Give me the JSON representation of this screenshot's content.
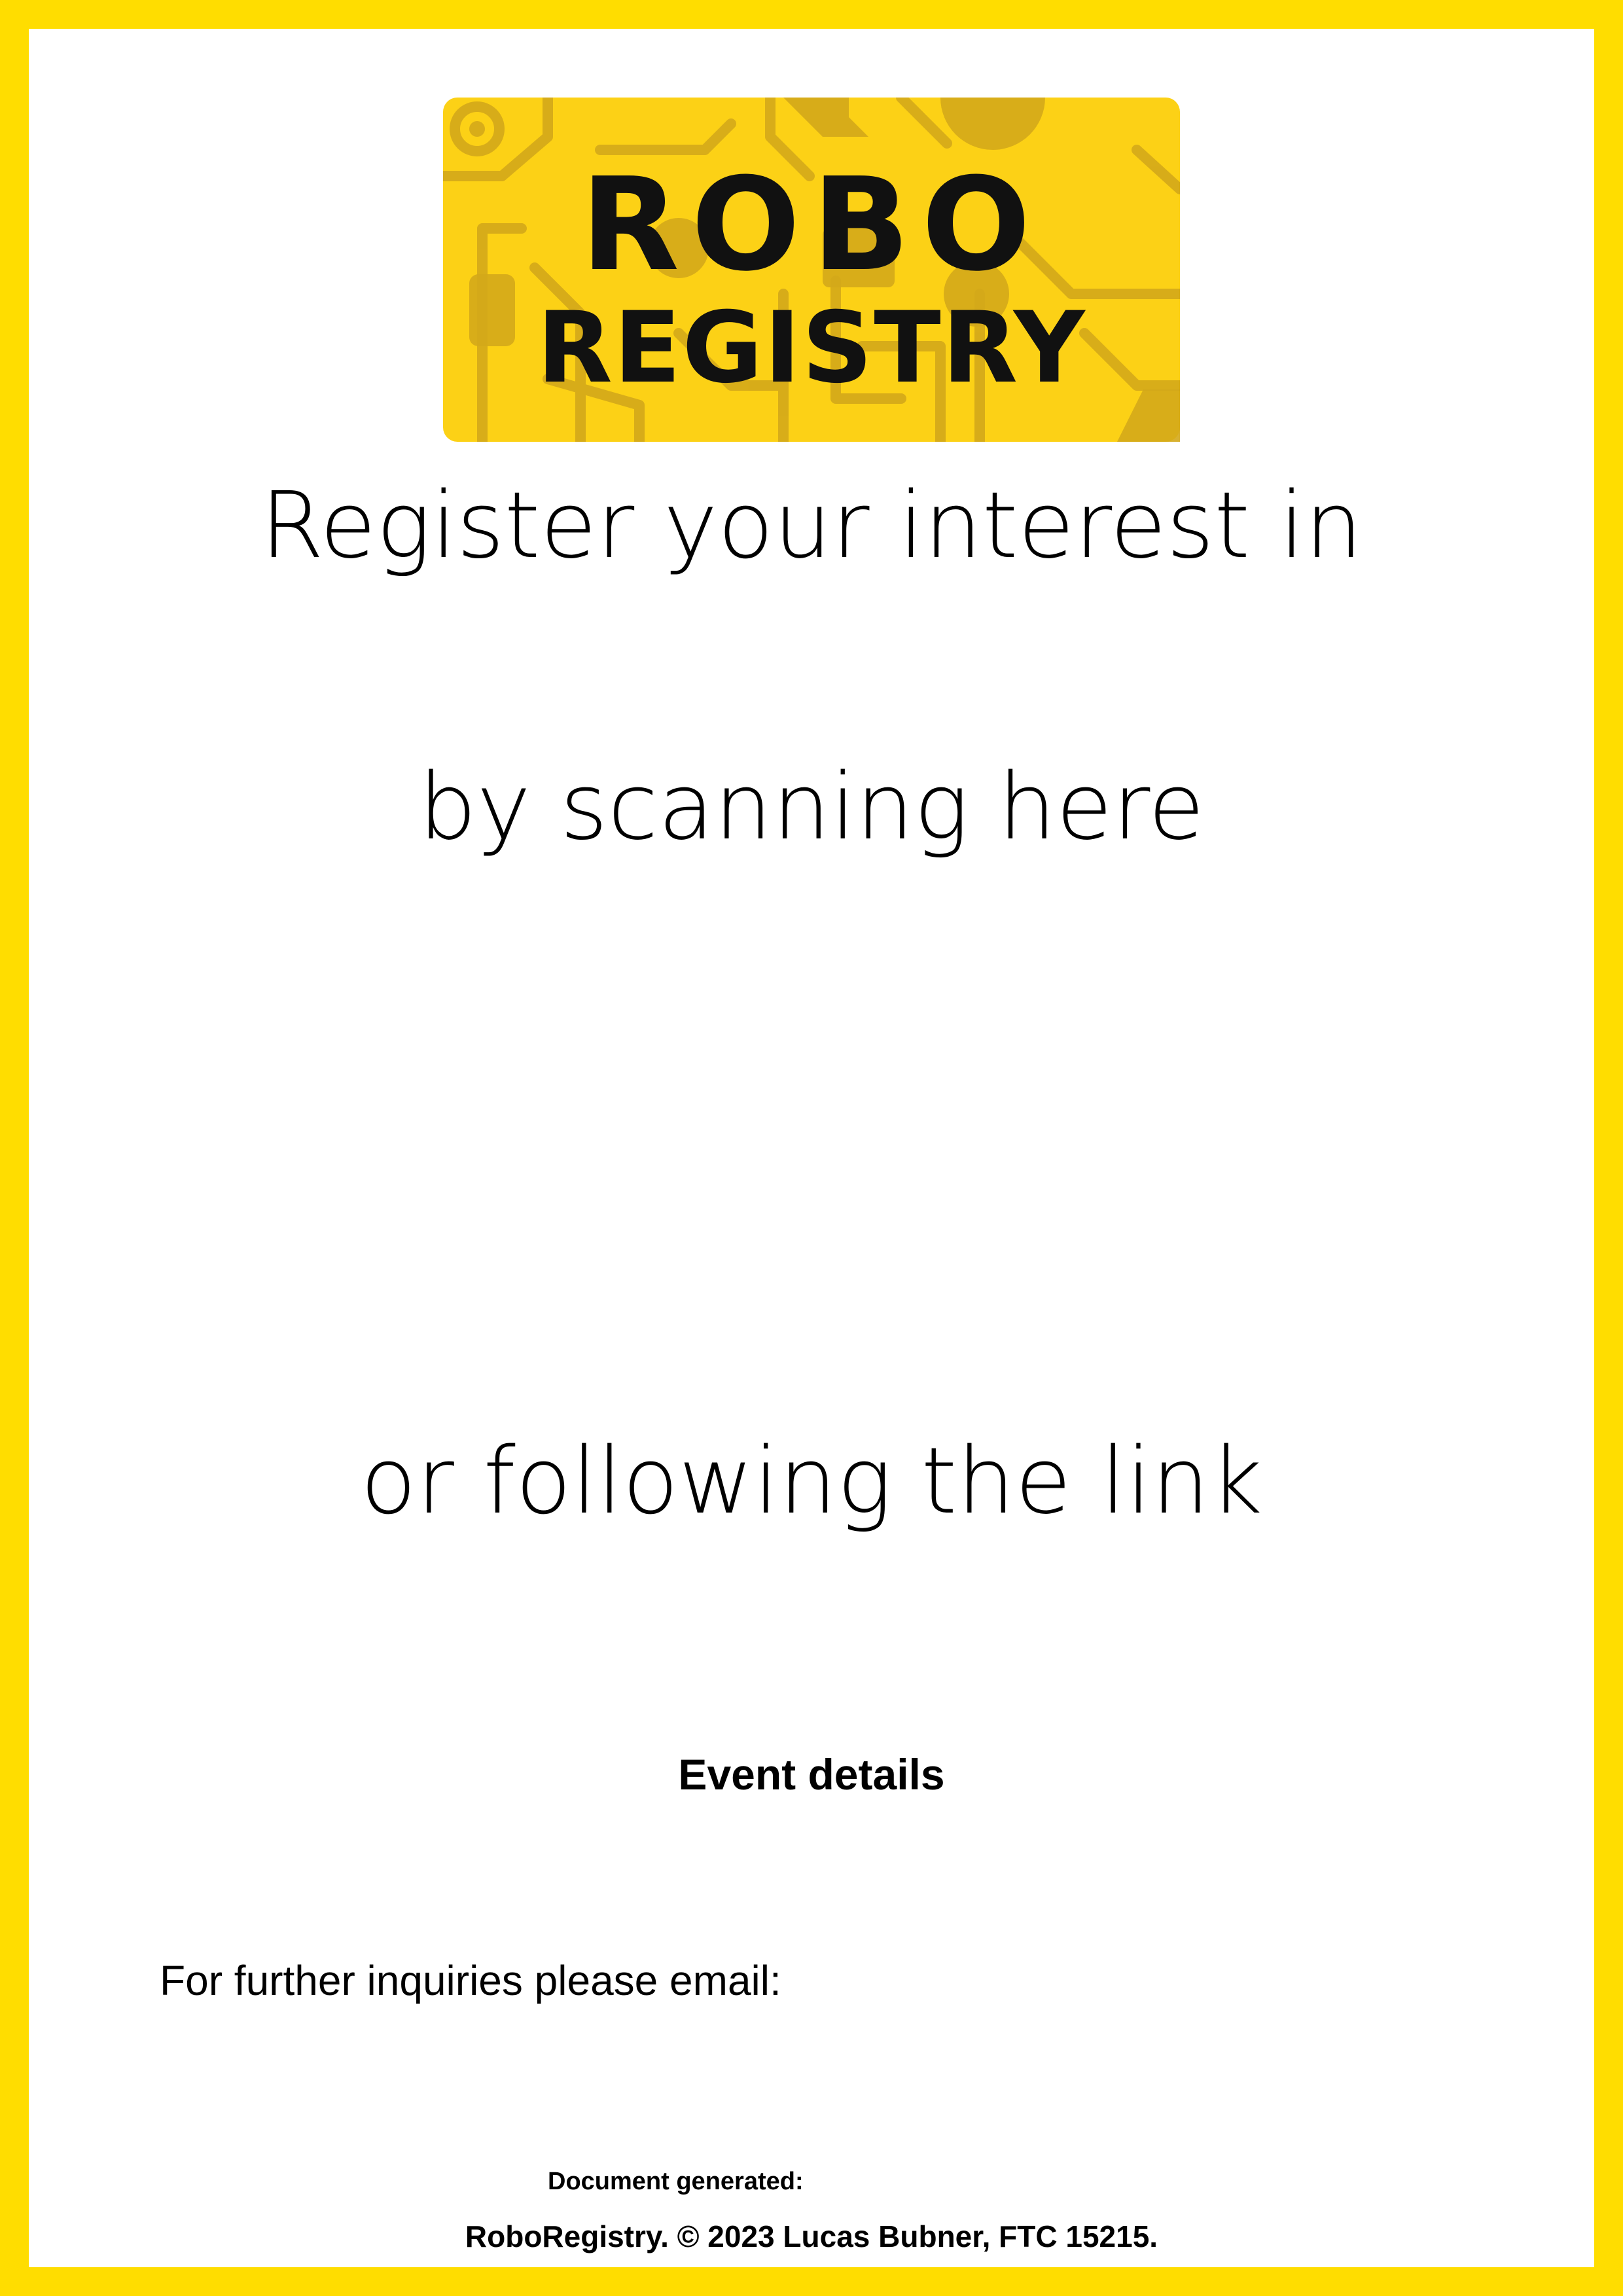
{
  "logo": {
    "line1": "ROBO",
    "line2": "REGISTRY",
    "background_color": "#FCD116",
    "pattern_color": "#D4A91A",
    "text_color": "#111111"
  },
  "border_color": "#FFDD00",
  "headings": {
    "line1": "Register your interest in",
    "line2": "by scanning here",
    "line3": "or following the link"
  },
  "event_details_label": "Event details",
  "inquiries_text": "For further inquiries please email:",
  "generated_label": "Document generated:",
  "footer_text": "RoboRegistry. © 2023 Lucas Bubner, FTC 15215."
}
